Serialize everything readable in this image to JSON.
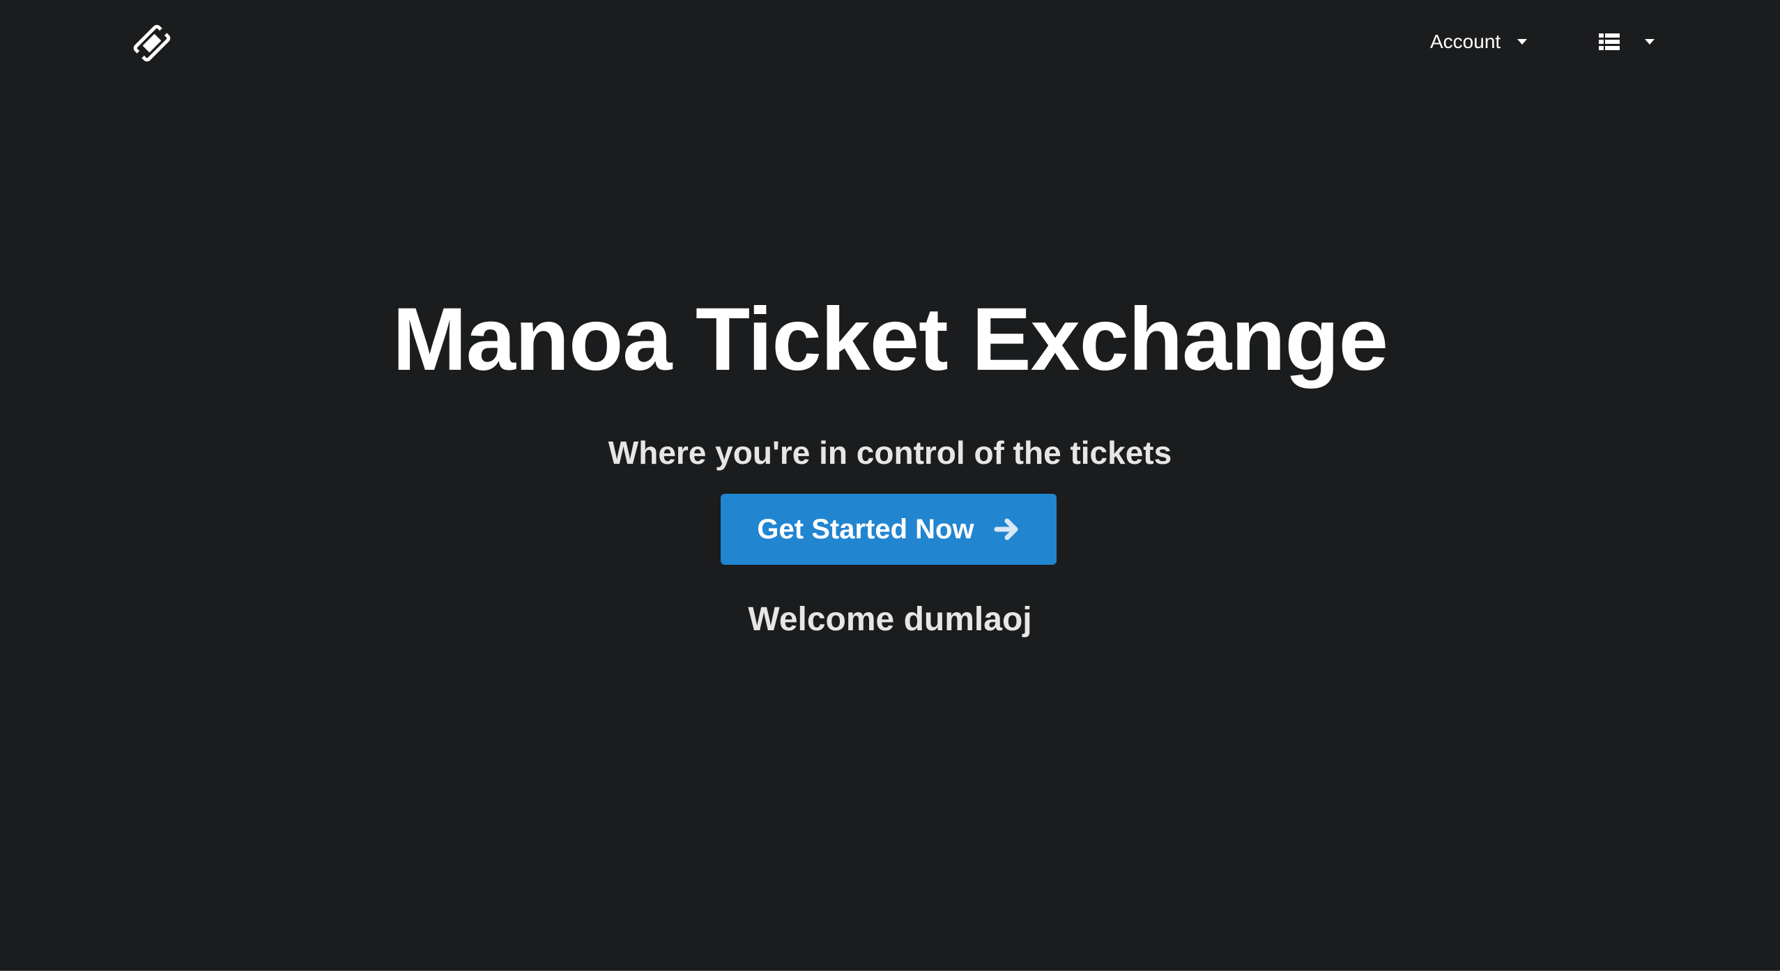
{
  "navbar": {
    "logo_icon": "ticket-icon",
    "account_label": "Account",
    "account_caret_icon": "caret-down-icon",
    "list_icon": "list-icon",
    "list_caret_icon": "caret-down-icon"
  },
  "hero": {
    "title": "Manoa Ticket Exchange",
    "subtitle": "Where you're in control of the tickets",
    "cta_label": "Get Started Now",
    "cta_icon": "arrow-right-icon",
    "welcome_prefix": "Welcome",
    "username": "dumlaoj"
  },
  "colors": {
    "background": "#1b1c1d",
    "primary_button": "#2185d0",
    "text": "#ffffff"
  }
}
